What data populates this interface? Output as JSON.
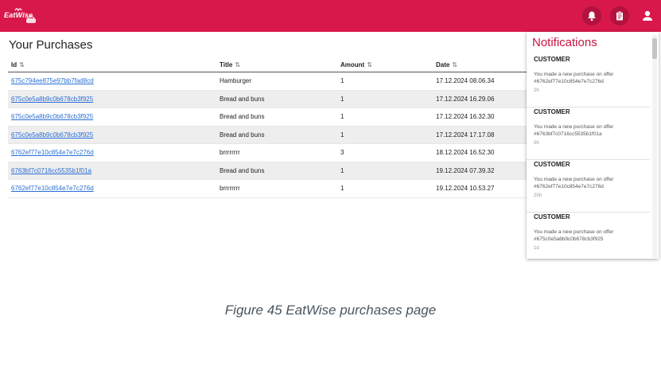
{
  "header": {
    "logo_text": "EatWise",
    "brand_color": "#d8174a",
    "icons": [
      "bell-icon",
      "clipboard-icon",
      "user-icon"
    ]
  },
  "page": {
    "title": "Your Purchases"
  },
  "table": {
    "columns": [
      "Id",
      "Title",
      "Amount",
      "Date"
    ],
    "sort_icon": "⇅",
    "rows": [
      {
        "id": "675c794ee875e97bb7fad8cd",
        "title": "Hamburger",
        "amount": "1",
        "date": "17.12.2024 08.06.34"
      },
      {
        "id": "675c0e5a8b9c0b678cb3f925",
        "title": "Bread and buns",
        "amount": "1",
        "date": "17.12.2024 16.29.06"
      },
      {
        "id": "675c0e5a8b9c0b678cb3f925",
        "title": "Bread and buns",
        "amount": "1",
        "date": "17.12.2024 16.32.30"
      },
      {
        "id": "675c0e5a8b9c0b678cb3f925",
        "title": "Bread and buns",
        "amount": "1",
        "date": "17.12.2024 17.17.08"
      },
      {
        "id": "6762ef77e10c854e7e7c276d",
        "title": "brrrrrrrr",
        "amount": "3",
        "date": "18.12.2024 16.52.30"
      },
      {
        "id": "6763bf7c0716cc5535b1f01a",
        "title": "Bread and buns",
        "amount": "1",
        "date": "19.12.2024 07.39.32"
      },
      {
        "id": "6762ef77e10c854e7e7c276d",
        "title": "brrrrrrrr",
        "amount": "1",
        "date": "19.12.2024 10.53.27"
      }
    ]
  },
  "notifications": {
    "title": "Notifications",
    "items": [
      {
        "heading": "CUSTOMER",
        "message": "You made a new purchase on offer #6762ef77e10c854e7e7c276d",
        "time": "2h"
      },
      {
        "heading": "CUSTOMER",
        "message": "You made a new purchase on offer #6763bf7c0716cc5535b1f01a",
        "time": "0h"
      },
      {
        "heading": "CUSTOMER",
        "message": "You made a new purchase on offer #6762ef77e10c854e7e7c276d",
        "time": "20h"
      },
      {
        "heading": "CUSTOMER",
        "message": "You made a new purchase on offer #675c0e5a8b9c0b678cb3f925",
        "time": "1d"
      }
    ]
  },
  "caption": "Figure 45 EatWise purchases page"
}
